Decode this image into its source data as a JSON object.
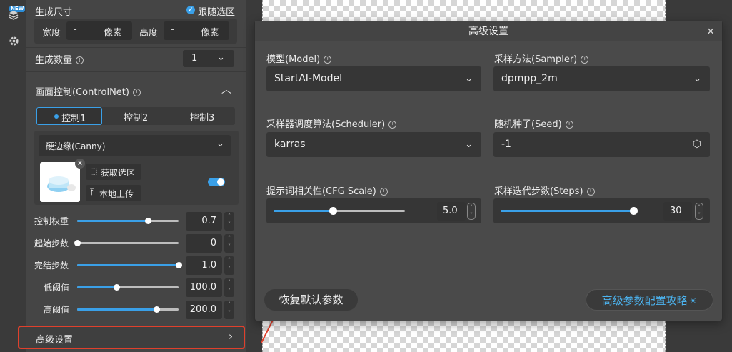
{
  "sidebar": {
    "new_badge": "NEW",
    "icons": [
      "layers-icon",
      "gear-icon"
    ]
  },
  "panel": {
    "gen_size": {
      "label": "生成尺寸",
      "follow_label": "跟随选区",
      "follow_checked": true,
      "width_label": "宽度",
      "width_value": "-",
      "width_unit": "像素",
      "height_label": "高度",
      "height_value": "-",
      "height_unit": "像素"
    },
    "gen_count": {
      "label": "生成数量",
      "value": "1"
    },
    "controlnet": {
      "label": "画面控制(ControlNet)",
      "tabs": [
        {
          "label": "控制1",
          "active": true
        },
        {
          "label": "控制2",
          "active": false
        },
        {
          "label": "控制3",
          "active": false
        }
      ],
      "model_select": "硬边缘(Canny)",
      "get_selection": "获取选区",
      "local_upload": "本地上传",
      "enabled": true,
      "sliders": [
        {
          "label": "控制权重",
          "value": "0.7",
          "fraction": 0.7
        },
        {
          "label": "起始步数",
          "value": "0",
          "fraction": 0.0
        },
        {
          "label": "完结步数",
          "value": "1.0",
          "fraction": 1.0
        },
        {
          "label": "低阈值",
          "value": "100.0",
          "fraction": 0.39
        },
        {
          "label": "高阈值",
          "value": "200.0",
          "fraction": 0.78
        }
      ]
    },
    "advanced": {
      "label": "高级设置",
      "chevron": "›"
    }
  },
  "dialog": {
    "title": "高级设置",
    "close": "×",
    "model_label": "模型(Model)",
    "model_value": "StartAI-Model",
    "sampler_label": "采样方法(Sampler)",
    "sampler_value": "dpmpp_2m",
    "scheduler_label": "采样器调度算法(Scheduler)",
    "scheduler_value": "karras",
    "seed_label": "随机种子(Seed)",
    "seed_value": "-1",
    "cfg_label": "提示词相关性(CFG Scale)",
    "cfg_value": "5.0",
    "cfg_fraction": 0.45,
    "steps_label": "采样迭代步数(Steps)",
    "steps_value": "30",
    "steps_fraction": 1.0,
    "reset_label": "恢复默认参数",
    "guide_label": "高级参数配置攻略"
  },
  "colors": {
    "accent": "#3aa0e8",
    "highlight": "#e0402c",
    "panel_bg": "#454545",
    "dialog_bg": "#4a4a4a"
  }
}
